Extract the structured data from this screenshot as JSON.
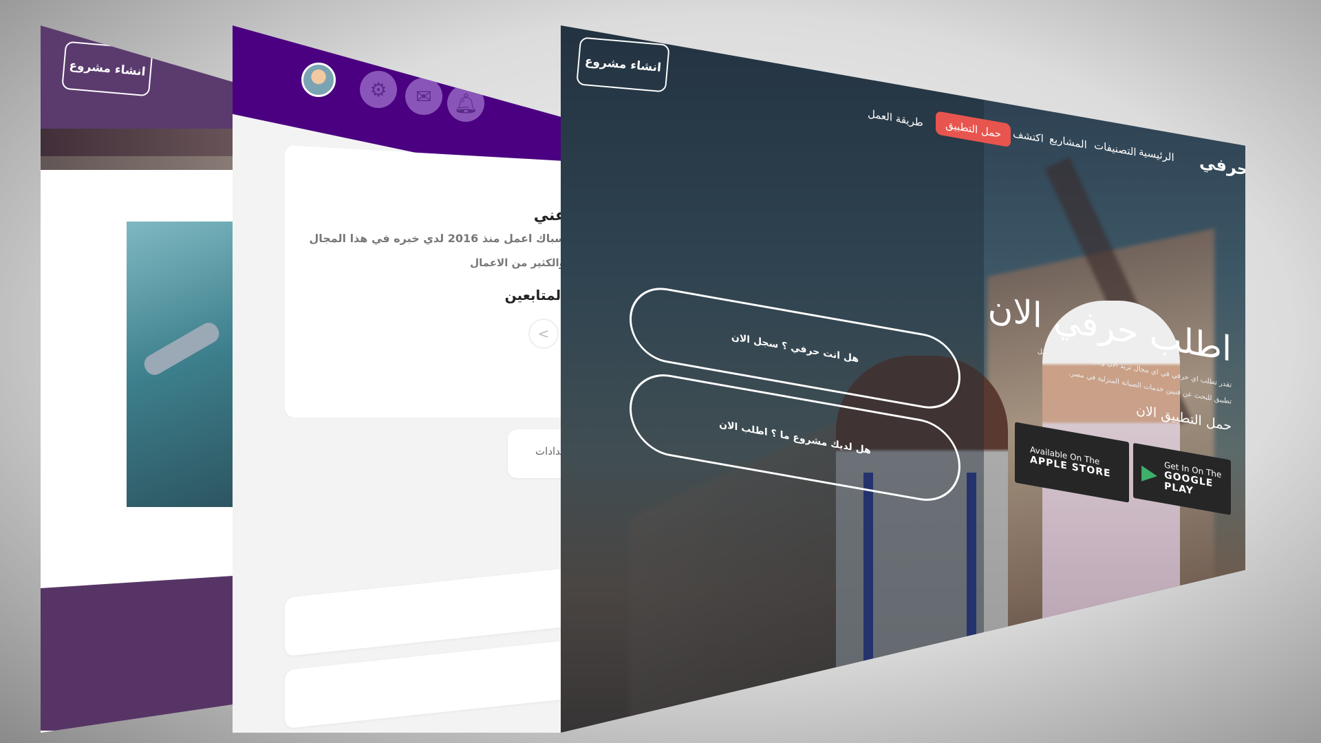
{
  "back_panel": {
    "create_project_label": "انشاء مشروع"
  },
  "middle_panel": {
    "header_icons": [
      "avatar",
      "gear-icon",
      "mail-icon",
      "bell-icon"
    ],
    "about": {
      "title": "عني",
      "line1": "سباك اعمل منذ 2016 لدي خبره في هذا المجال",
      "line2": "والكثير من الاعمال"
    },
    "followers_title": "المتابعين",
    "carousel_prev": "<",
    "counters_label": "عدادات",
    "header_color": "#4a0080"
  },
  "front_panel": {
    "create_project_label": "انشاء مشروع",
    "logo_text": "حرفي",
    "nav": {
      "home": "الرئيسية",
      "categories": "التصنيفات",
      "projects": "المشاريع",
      "explore": "اكتشف",
      "download_app": "حمل التطبيق",
      "how_it_works": "طريقة العمل"
    },
    "cta_color": "#e8554e",
    "hero": {
      "title": "اطلب حرفي الان",
      "paragraph": "تقدر تطلب اي حرفي في اي مجال تريد الان وبكل سهوله وثقه اسهل تطبيق للبحث عن فنيين خدمات الصيانة المنزلية في مصر.",
      "download_heading": "حمل التطبيق الان"
    },
    "stores": {
      "apple": {
        "line1": "Available On The",
        "line2": "APPLE STORE"
      },
      "google": {
        "line1": "Get In On The",
        "line2": "GOOGLE PLAY"
      }
    },
    "buttons": {
      "craftsman": "هل انت حرفي ؟ سجل الان",
      "project": "هل لديك مشروع ما ؟ اطلب الان"
    }
  }
}
